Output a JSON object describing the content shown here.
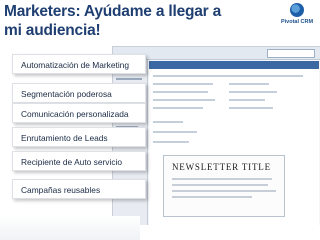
{
  "title": "Marketers: Ayúdame  a llegar a mi audiencia!",
  "logo": {
    "text": "Pivotal CRM"
  },
  "features": [
    "Automatización de Marketing",
    "Segmentación poderosa",
    "Comunicación personalizada",
    "Enrutamiento de Leads",
    "Recipiente de Auto servicio",
    "Campañas reusables"
  ],
  "screenshot": {
    "newsletter_title": "NEWSLETTER TITLE"
  }
}
